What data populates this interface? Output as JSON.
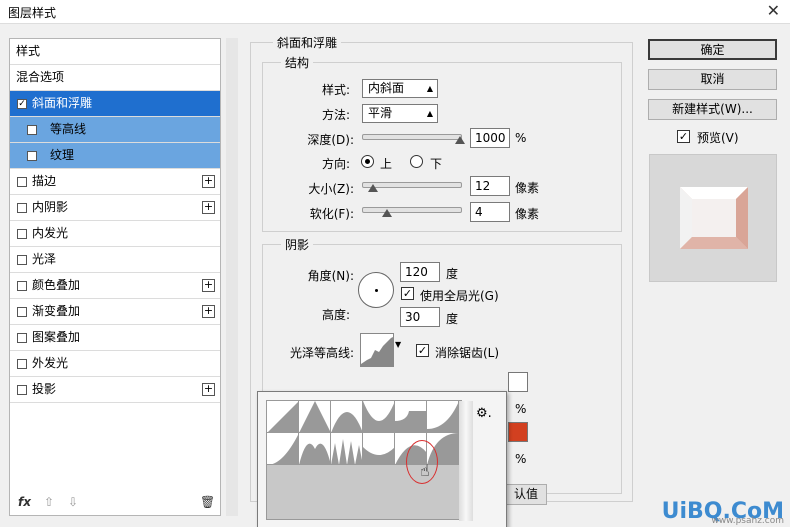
{
  "window": {
    "title": "图层样式",
    "close_glyph": "✕"
  },
  "style_list": {
    "header": "样式",
    "items": [
      {
        "label": "混合选项",
        "checked": null,
        "plus": false,
        "state": "normal"
      },
      {
        "label": "斜面和浮雕",
        "checked": true,
        "plus": false,
        "state": "active"
      },
      {
        "label": "等高线",
        "checked": false,
        "plus": false,
        "state": "sub"
      },
      {
        "label": "纹理",
        "checked": false,
        "plus": false,
        "state": "sub"
      },
      {
        "label": "描边",
        "checked": false,
        "plus": true,
        "state": "normal"
      },
      {
        "label": "内阴影",
        "checked": false,
        "plus": true,
        "state": "normal"
      },
      {
        "label": "内发光",
        "checked": false,
        "plus": false,
        "state": "normal"
      },
      {
        "label": "光泽",
        "checked": false,
        "plus": false,
        "state": "normal"
      },
      {
        "label": "颜色叠加",
        "checked": false,
        "plus": true,
        "state": "normal"
      },
      {
        "label": "渐变叠加",
        "checked": false,
        "plus": true,
        "state": "normal"
      },
      {
        "label": "图案叠加",
        "checked": false,
        "plus": false,
        "state": "normal"
      },
      {
        "label": "外发光",
        "checked": false,
        "plus": false,
        "state": "normal"
      },
      {
        "label": "投影",
        "checked": false,
        "plus": true,
        "state": "normal"
      }
    ],
    "bottom": {
      "fx": "fx",
      "up": "⇧",
      "down": "⇩",
      "trash": "🗑"
    }
  },
  "bevel": {
    "section_title": "斜面和浮雕",
    "structure_title": "结构",
    "style_label": "样式:",
    "style_value": "内斜面",
    "technique_label": "方法:",
    "technique_value": "平滑",
    "depth_label": "深度(D):",
    "depth_value": "1000",
    "depth_unit": "%",
    "direction_label": "方向:",
    "direction_up": "上",
    "direction_down": "下",
    "size_label": "大小(Z):",
    "size_value": "12",
    "size_unit": "像素",
    "soften_label": "软化(F):",
    "soften_value": "4",
    "soften_unit": "像素"
  },
  "shading": {
    "title": "阴影",
    "angle_label": "角度(N):",
    "angle_value": "120",
    "angle_unit": "度",
    "global_light_label": "使用全局光(G)",
    "altitude_label": "高度:",
    "altitude_value": "30",
    "altitude_unit": "度",
    "gloss_contour_label": "光泽等高线:",
    "anti_alias_label": "消除锯齿(L)",
    "pct1": "%",
    "pct2": "%",
    "reset_label": "认值"
  },
  "buttons": {
    "ok": "确定",
    "cancel": "取消",
    "new_style": "新建样式(W)...",
    "preview": "预览(V)"
  },
  "popup": {
    "gear": "⚙."
  },
  "colors": {
    "active": "#1f6fcf",
    "sub": "#6aa5e0",
    "shadow_color": "#d24020",
    "highlight_color": "#ffffff"
  },
  "watermark": {
    "logo": "UiBQ.CoM",
    "sub": "www.psahz.com"
  }
}
